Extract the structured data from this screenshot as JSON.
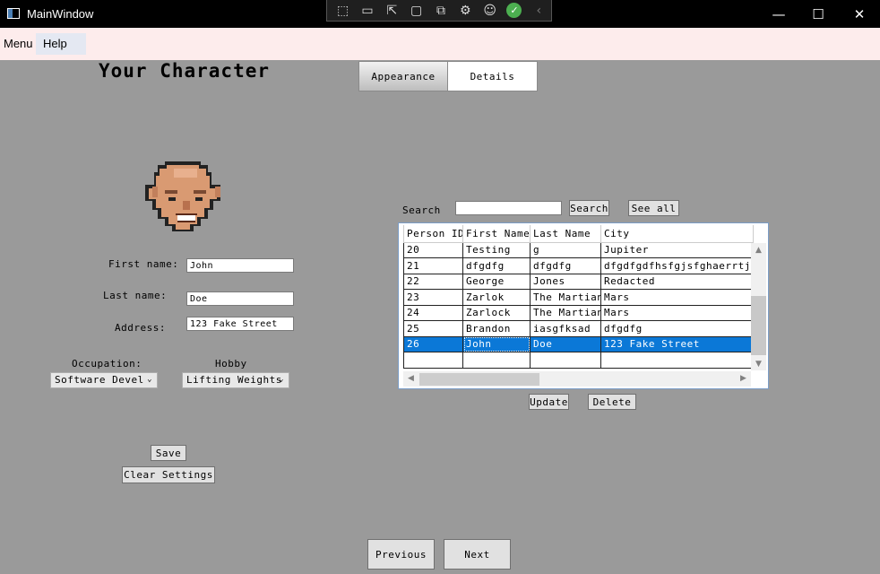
{
  "window": {
    "title": "MainWindow"
  },
  "debug_toolbar": {
    "icons": [
      "select-element-icon",
      "live-visual-tree-icon",
      "select-mode-icon",
      "display-adorners-icon",
      "track-focus-icon",
      "binding-failures-icon",
      "accessibility-icon",
      "check-icon",
      "collapse-icon"
    ]
  },
  "window_controls": {
    "minimize": "—",
    "maximize": "☐",
    "close": "✕"
  },
  "menu": {
    "items": [
      "Menu",
      "Help"
    ]
  },
  "character": {
    "title": "Your Character",
    "labels": {
      "first_name": "First name:",
      "last_name": "Last name:",
      "address": "Address:",
      "occupation": "Occupation:",
      "hobby": "Hobby"
    },
    "values": {
      "first_name": "John",
      "last_name": "Doe",
      "address": "123 Fake Street",
      "occupation": "Software Devel",
      "hobby": "Lifting Weights"
    },
    "save_label": "Save",
    "clear_label": "Clear Settings"
  },
  "tabs": [
    "Appearance",
    "Details"
  ],
  "search": {
    "label": "Search",
    "value": "",
    "button": "Search",
    "see_all": "See all"
  },
  "table": {
    "columns": [
      "Person ID",
      "First Name",
      "Last Name",
      "City"
    ],
    "rows": [
      [
        "20",
        "Testing",
        "g",
        "Jupiter"
      ],
      [
        "21",
        "dfgdfg",
        "dfgdfg",
        "dfgdfgdfhsfgjsfghaerrtjh"
      ],
      [
        "22",
        "George",
        "Jones",
        "Redacted"
      ],
      [
        "23",
        "Zarlok",
        "The Martian",
        "Mars"
      ],
      [
        "24",
        "Zarlock",
        "The Martian",
        "Mars"
      ],
      [
        "25",
        "Brandon",
        "iasgfksad",
        "dfgdfg"
      ],
      [
        "26",
        "John",
        "Doe",
        "123 Fake Street"
      ]
    ],
    "selected_row": 6
  },
  "table_actions": {
    "update": "Update",
    "delete": "Delete"
  },
  "nav": {
    "previous": "Previous",
    "next": "Next"
  },
  "colors": {
    "selection": "#0b78d7",
    "window_bg": "#9a9a9a",
    "menu_bg": "#fdecec"
  }
}
